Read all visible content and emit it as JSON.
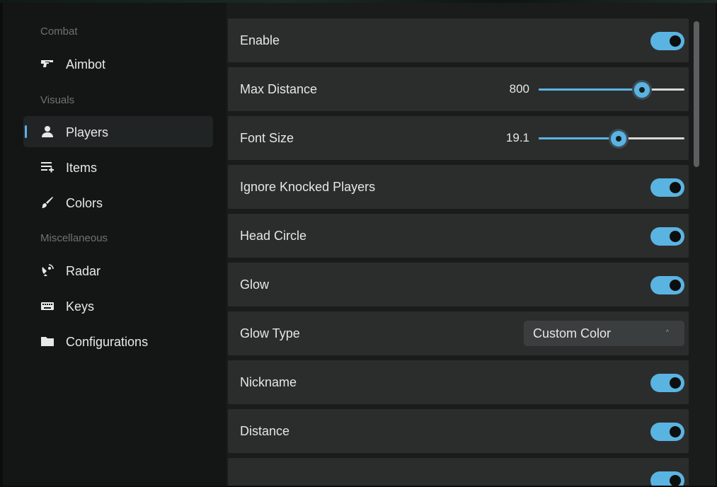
{
  "sidebar": {
    "sections": [
      {
        "title": "Combat"
      },
      {
        "title": "Visuals"
      },
      {
        "title": "Miscellaneous"
      }
    ],
    "items": [
      {
        "label": "Aimbot",
        "icon": "gun-icon"
      },
      {
        "label": "Players",
        "icon": "person-icon",
        "active": true
      },
      {
        "label": "Items",
        "icon": "list-add-icon"
      },
      {
        "label": "Colors",
        "icon": "brush-icon"
      },
      {
        "label": "Radar",
        "icon": "satellite-icon"
      },
      {
        "label": "Keys",
        "icon": "keyboard-icon"
      },
      {
        "label": "Configurations",
        "icon": "folder-icon"
      }
    ]
  },
  "settings": [
    {
      "label": "Enable",
      "type": "toggle",
      "on": true
    },
    {
      "label": "Max Distance",
      "type": "slider",
      "value": "800",
      "fraction": 0.71
    },
    {
      "label": "Font Size",
      "type": "slider",
      "value": "19.1",
      "fraction": 0.55
    },
    {
      "label": "Ignore Knocked Players",
      "type": "toggle",
      "on": true
    },
    {
      "label": "Head Circle",
      "type": "toggle",
      "on": true
    },
    {
      "label": "Glow",
      "type": "toggle",
      "on": true
    },
    {
      "label": "Glow Type",
      "type": "dropdown",
      "value": "Custom Color",
      "arrow": "^"
    },
    {
      "label": "Nickname",
      "type": "toggle",
      "on": true
    },
    {
      "label": "Distance",
      "type": "toggle",
      "on": true
    },
    {
      "label": "",
      "type": "toggle",
      "on": true
    }
  ],
  "colors": {
    "accent": "#5ab4e2",
    "row_bg": "#2b2d2d",
    "sidebar_bg": "#141616",
    "section_text": "#6d7272"
  }
}
